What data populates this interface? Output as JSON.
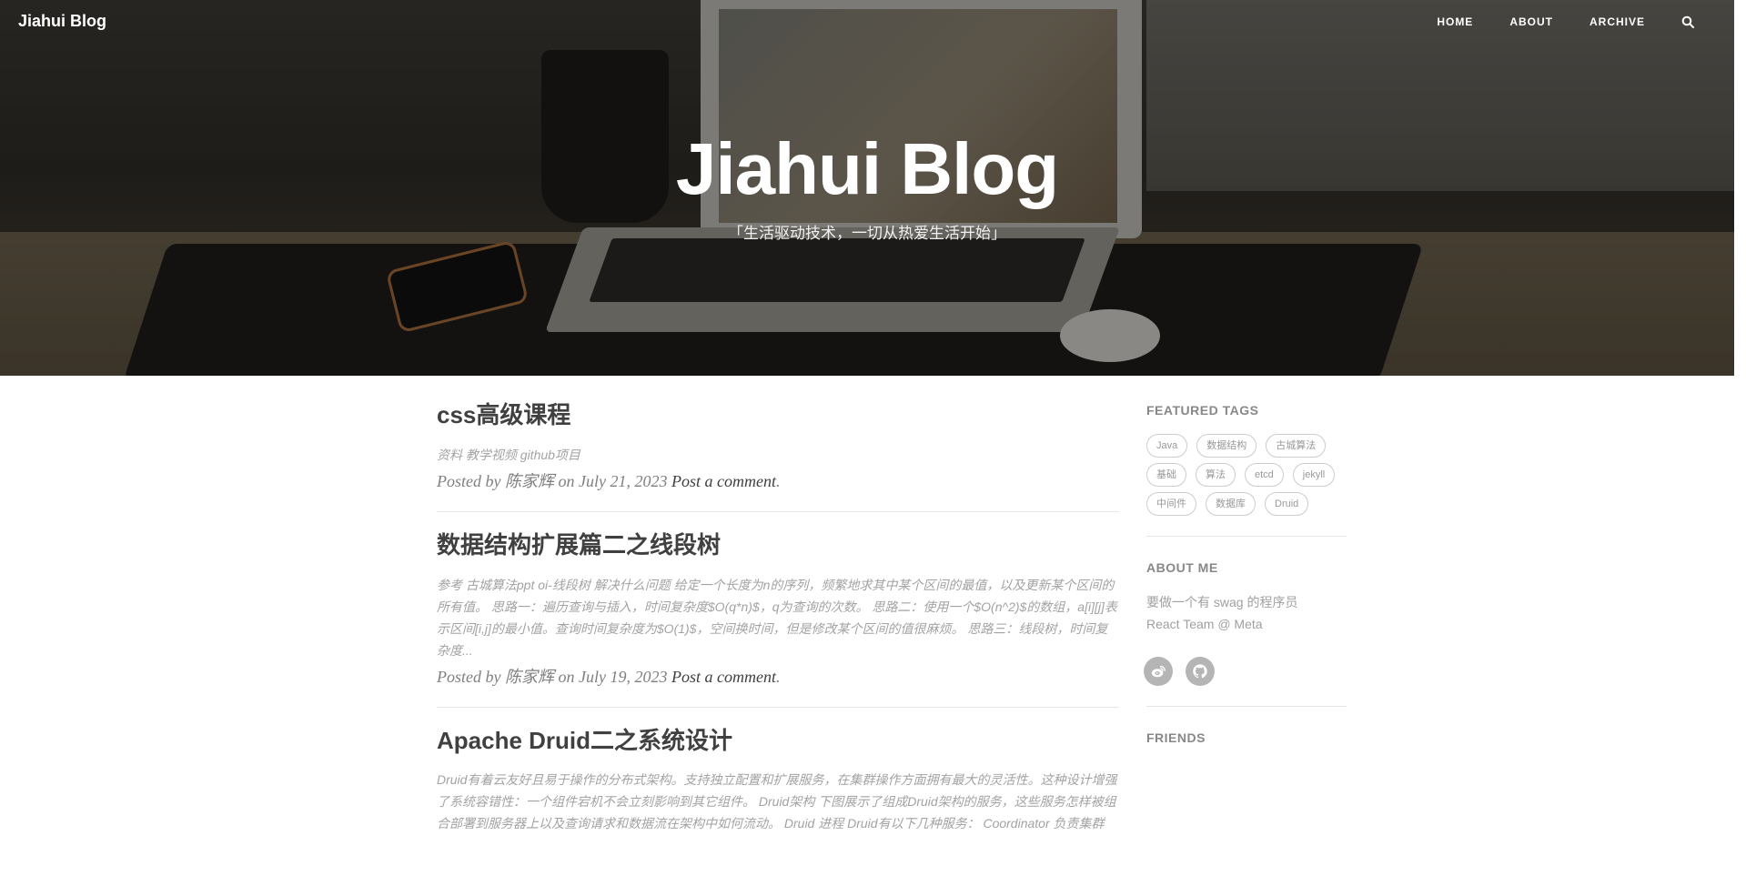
{
  "site": {
    "brand": "Jiahui Blog"
  },
  "nav": {
    "items": [
      "HOME",
      "ABOUT",
      "ARCHIVE"
    ]
  },
  "hero": {
    "title": "Jiahui Blog",
    "subtitle": "「生活驱动技术，一切从热爱生活开始」"
  },
  "posts": [
    {
      "title": "css高级课程",
      "excerpt": "资料 教学视频 github项目",
      "meta_prefix": "Posted by 陈家辉 on July 21, 2023 ",
      "comment": "Post a comment",
      "meta_suffix": "."
    },
    {
      "title": "数据结构扩展篇二之线段树",
      "excerpt": "参考 古城算法ppt oi-线段树 解决什么问题 给定一个长度为n的序列，频繁地求其中某个区间的最值，以及更新某个区间的所有值。 思路一：遍历查询与插入，时间复杂度$O(q*n)$，q为查询的次数。 思路二：使用一个$O(n^2)$的数组，a[i][j]表示区间[i,j]的最小值。查询时间复杂度为$O(1)$，空间换时间，但是修改某个区间的值很麻烦。 思路三：线段树，时间复杂度...",
      "meta_prefix": "Posted by 陈家辉 on July 19, 2023 ",
      "comment": "Post a comment",
      "meta_suffix": "."
    },
    {
      "title": "Apache Druid二之系统设计",
      "excerpt": "Druid有着云友好且易于操作的分布式架构。支持独立配置和扩展服务，在集群操作方面拥有最大的灵活性。这种设计增强了系统容错性：一个组件宕机不会立刻影响到其它组件。 Druid架构 下图展示了组成Druid架构的服务，这些服务怎样被组合部署到服务器上以及查询请求和数据流在架构中如何流动。 Druid 进程 Druid有以下几种服务： Coordinator 负责集群"
    }
  ],
  "sidebar": {
    "featured_tags_title": "FEATURED TAGS",
    "tags": [
      "Java",
      "数据结构",
      "古城算法",
      "基础",
      "算法",
      "etcd",
      "jekyll",
      "中间件",
      "数据库",
      "Druid"
    ],
    "about_title": "ABOUT ME",
    "about_line1": "要做一个有 swag 的程序员",
    "about_line2": "React Team @ Meta",
    "socials": [
      "weibo-icon",
      "github-icon"
    ],
    "friends_title": "FRIENDS"
  }
}
